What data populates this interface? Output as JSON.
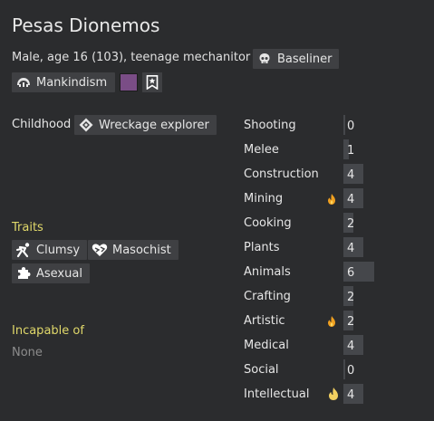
{
  "header": {
    "name": "Pesas Dionemos",
    "description": "Male, age 16 (103), teenage mechanitor",
    "xenotype_label": "Baseliner",
    "xenotype_icon": "skull-icon",
    "ideology_label": "Mankindism",
    "ideology_icon": "ideoligion-icon",
    "favorite_color": "#7a4d86",
    "role_icon": "bookmark-star-icon"
  },
  "backstory": {
    "label": "Childhood",
    "value": "Wreckage explorer",
    "icon": "diamond-icon"
  },
  "traits": {
    "heading": "Traits",
    "items": [
      {
        "label": "Clumsy",
        "icon": "clumsy-icon"
      },
      {
        "label": "Masochist",
        "icon": "masochist-heart-icon"
      },
      {
        "label": "Asexual",
        "icon": "puzzle-icon"
      }
    ]
  },
  "incapable": {
    "heading": "Incapable of",
    "value": "None"
  },
  "skills": [
    {
      "name": "Shooting",
      "level": 0,
      "passion": "none"
    },
    {
      "name": "Melee",
      "level": 1,
      "passion": "none"
    },
    {
      "name": "Construction",
      "level": 4,
      "passion": "none"
    },
    {
      "name": "Mining",
      "level": 4,
      "passion": "minor"
    },
    {
      "name": "Cooking",
      "level": 2,
      "passion": "none"
    },
    {
      "name": "Plants",
      "level": 4,
      "passion": "none"
    },
    {
      "name": "Animals",
      "level": 6,
      "passion": "none"
    },
    {
      "name": "Crafting",
      "level": 2,
      "passion": "none"
    },
    {
      "name": "Artistic",
      "level": 2,
      "passion": "minor"
    },
    {
      "name": "Medical",
      "level": 4,
      "passion": "none"
    },
    {
      "name": "Social",
      "level": 0,
      "passion": "none"
    },
    {
      "name": "Intellectual",
      "level": 4,
      "passion": "major"
    }
  ],
  "colors": {
    "background": "#2b2c2e",
    "chip": "#3f4043",
    "skill_bar": "#45474b",
    "heading_yellow": "#e0d86a",
    "passion_flame": "#f0a020"
  }
}
